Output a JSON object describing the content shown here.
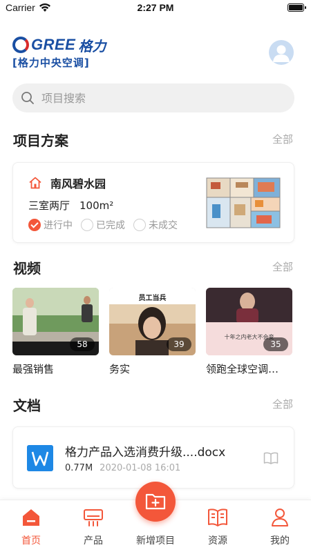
{
  "status_bar": {
    "carrier": "Carrier",
    "time": "2:27 PM",
    "icons": [
      "wifi-icon",
      "battery-icon"
    ]
  },
  "brand": {
    "logo_word": "GREE",
    "logo_cn": "格力",
    "subtitle": "[格力中央空调]"
  },
  "search": {
    "placeholder": "项目搜索",
    "icon": "search-icon"
  },
  "sections": {
    "projects": {
      "title": "项目方案",
      "more": "全部"
    },
    "videos": {
      "title": "视频",
      "more": "全部"
    },
    "docs": {
      "title": "文档",
      "more": "全部"
    }
  },
  "project": {
    "name": "南风碧水园",
    "layout": "三室两厅",
    "area": "100m²",
    "statuses": [
      {
        "label": "进行中",
        "checked": true
      },
      {
        "label": "已完成",
        "checked": false
      },
      {
        "label": "未成交",
        "checked": false
      }
    ]
  },
  "videos": [
    {
      "title": "最强销售",
      "count": "58"
    },
    {
      "title": "务实",
      "count": "39",
      "overlay_text": "员工当兵"
    },
    {
      "title": "领跑全球空调…",
      "count": "35",
      "overlay_text": "十年之内老大不会变"
    }
  ],
  "document": {
    "name": "格力产品入选消费升级....docx",
    "size": "0.77M",
    "date": "2020-01-08 16:01"
  },
  "tabbar": {
    "tabs": [
      {
        "label": "首页",
        "icon": "home-icon",
        "active": true
      },
      {
        "label": "产品",
        "icon": "air-conditioner-icon",
        "active": false
      },
      {
        "label": "新增项目",
        "icon": "add-folder-icon",
        "active": false
      },
      {
        "label": "资源",
        "icon": "book-icon",
        "active": false
      },
      {
        "label": "我的",
        "icon": "person-icon",
        "active": false
      }
    ]
  },
  "colors": {
    "accent": "#f3573a",
    "brand_blue": "#1a4fa3",
    "doc_blue": "#1e88e5"
  }
}
